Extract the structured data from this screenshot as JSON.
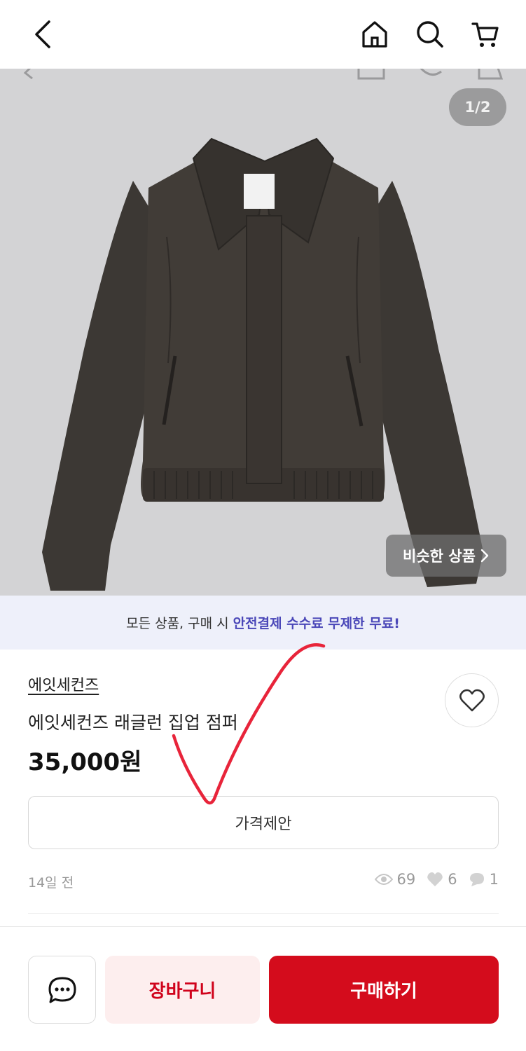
{
  "header": {
    "back_icon": "chevron-left-icon",
    "home_icon": "home-icon",
    "search_icon": "search-icon",
    "cart_icon": "cart-icon"
  },
  "gallery": {
    "counter": "1/2",
    "similar_label": "비슷한 상품",
    "similar_icon": "chevron-right-icon",
    "image_alt": "jacket-photo"
  },
  "promo": {
    "text": "모든 상품, 구매 시",
    "highlight": "안전결제 수수료 무제한 무료!"
  },
  "product": {
    "seller": "에잇세컨즈",
    "title": "에잇세컨즈 래글런 집업 점퍼",
    "price": "35,000원",
    "like_icon": "heart-outline-icon",
    "offer_label": "가격제안",
    "posted": "14일 전",
    "views": "69",
    "likes": "6",
    "comments": "1"
  },
  "actions": {
    "chat_icon": "chat-bubble-icon",
    "cart_label": "장바구니",
    "buy_label": "구매하기"
  },
  "colors": {
    "accent_red": "#d40c1c",
    "promo_blue": "#4a47b8",
    "annotation_red": "#e8243a"
  }
}
